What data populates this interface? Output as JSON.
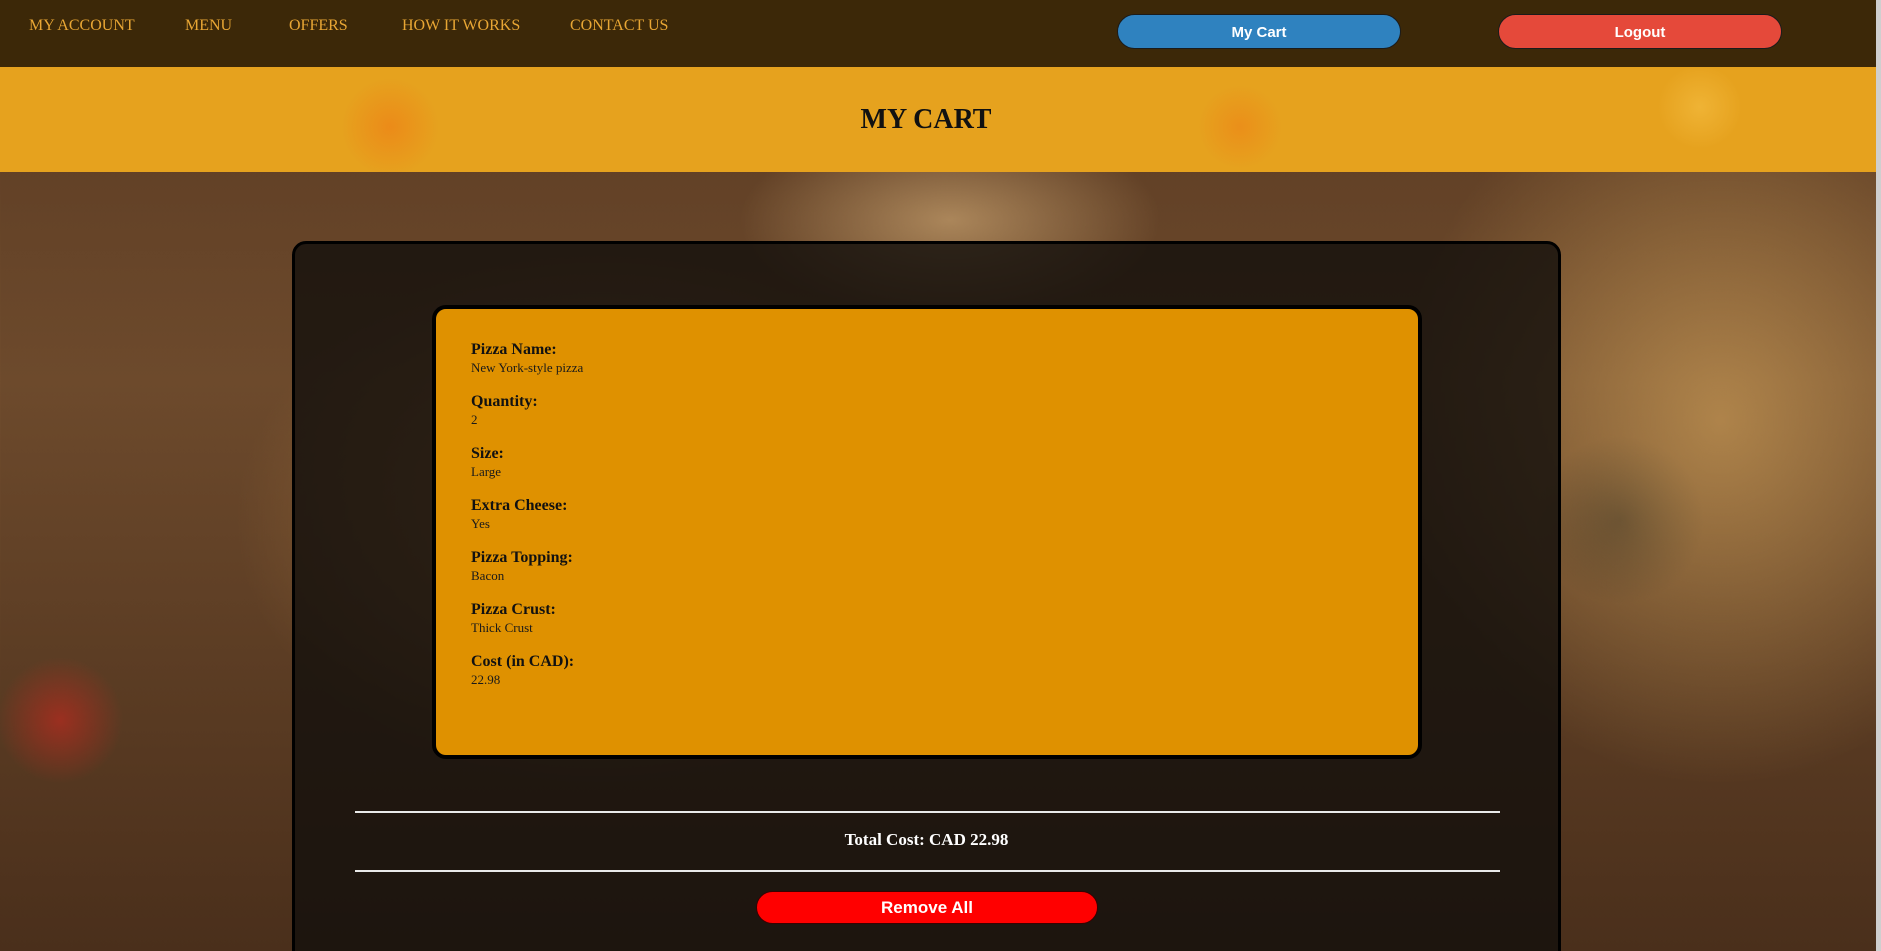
{
  "nav": {
    "links": [
      "MY ACCOUNT",
      "MENU",
      "OFFERS",
      "HOW IT WORKS",
      "CONTACT US"
    ],
    "cart_label": "My Cart",
    "logout_label": "Logout"
  },
  "header": {
    "title": "MY CART"
  },
  "cart": {
    "item": {
      "fields": [
        {
          "label": "Pizza Name:",
          "value": "New York-style pizza"
        },
        {
          "label": "Quantity:",
          "value": "2"
        },
        {
          "label": "Size:",
          "value": "Large"
        },
        {
          "label": "Extra Cheese:",
          "value": "Yes"
        },
        {
          "label": "Pizza Topping:",
          "value": "Bacon"
        },
        {
          "label": "Pizza Crust:",
          "value": "Thick Crust"
        },
        {
          "label": "Cost (in CAD):",
          "value": "22.98"
        }
      ]
    },
    "total_label": "Total Cost: CAD 22.98",
    "remove_all_label": "Remove All"
  },
  "colors": {
    "nav_link": "#e8a634",
    "cart_button": "#2f82bf",
    "logout_button": "#e5493a",
    "banner": "#e6a21e",
    "item_card": "#df9100",
    "remove_button": "#ff0000"
  }
}
